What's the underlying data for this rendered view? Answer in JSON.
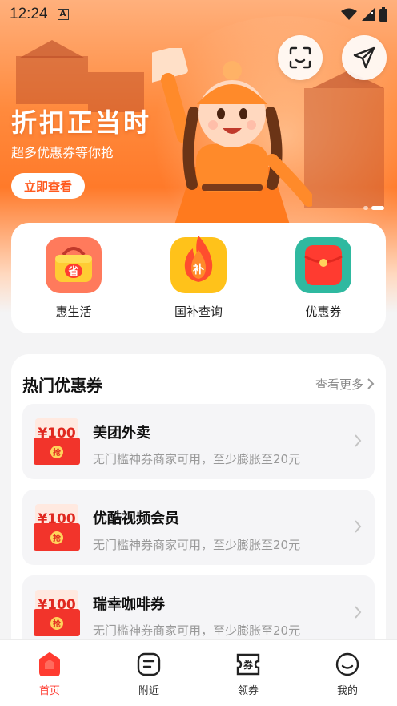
{
  "status_bar": {
    "time": "12:24",
    "notification_badge": "A"
  },
  "banner": {
    "headline": "折扣正当时",
    "subline": "超多优惠券等你抢",
    "cta_label": "立即查看",
    "accent": "#ff7a2a"
  },
  "top_actions": {
    "scan_icon": "scan-icon",
    "share_icon": "send-icon"
  },
  "quick_entries": [
    {
      "label": "惠生活",
      "icon": "basket-icon",
      "badge": "省"
    },
    {
      "label": "国补查询",
      "icon": "flame-icon",
      "badge": "补"
    },
    {
      "label": "优惠券",
      "icon": "red-envelope-icon",
      "badge": ""
    }
  ],
  "hot_section": {
    "title": "热门优惠券",
    "more_label": "查看更多",
    "coupons": [
      {
        "amount": "¥100",
        "stamp": "抢",
        "name": "美团外卖",
        "desc": "无门槛神券商家可用，至少膨胀至20元"
      },
      {
        "amount": "¥100",
        "stamp": "抢",
        "name": "优酷视频会员",
        "desc": "无门槛神券商家可用，至少膨胀至20元"
      },
      {
        "amount": "¥100",
        "stamp": "抢",
        "name": "瑞幸咖啡券",
        "desc": "无门槛神券商家可用，至少膨胀至20元"
      }
    ]
  },
  "bottom_nav": [
    {
      "label": "首页",
      "icon": "home-icon",
      "active": true
    },
    {
      "label": "附近",
      "icon": "nearby-icon",
      "active": false
    },
    {
      "label": "领券",
      "icon": "coupon-icon",
      "active": false
    },
    {
      "label": "我的",
      "icon": "profile-icon",
      "active": false
    }
  ],
  "colors": {
    "primary_red": "#ff3b30",
    "coupon_red": "#f2342b"
  }
}
